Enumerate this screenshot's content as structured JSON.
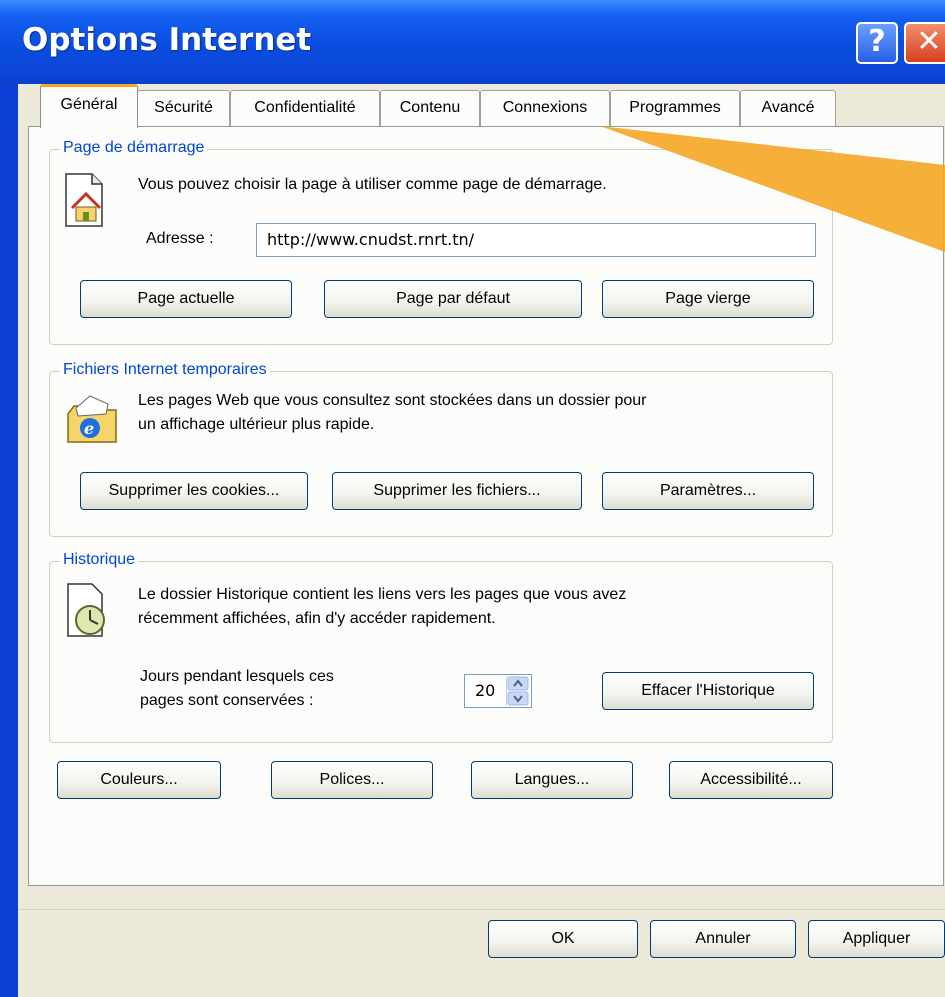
{
  "window": {
    "title": "Options Internet",
    "help_label": "?",
    "close_label": "✕"
  },
  "tabs": [
    "Général",
    "Sécurité",
    "Confidentialité",
    "Contenu",
    "Connexions",
    "Programmes",
    "Avancé"
  ],
  "home": {
    "legend": "Page de démarrage",
    "description": "Vous pouvez choisir la page à utiliser comme page de démarrage.",
    "address_label": "Adresse :",
    "address_value": "http://www.cnudst.rnrt.tn/",
    "buttons": [
      "Page actuelle",
      "Page par défaut",
      "Page vierge"
    ]
  },
  "temp": {
    "legend": "Fichiers Internet temporaires",
    "desc1": "Les pages Web que vous consultez sont stockées dans un dossier pour",
    "desc2": "un affichage ultérieur plus rapide.",
    "buttons": [
      "Supprimer les cookies...",
      "Supprimer les fichiers...",
      "Paramètres..."
    ]
  },
  "history": {
    "legend": "Historique",
    "desc1": "Le dossier Historique contient les liens vers les pages que vous avez",
    "desc2": "récemment affichées, afin d'y accéder rapidement.",
    "days_label1": "Jours pendant lesquels ces",
    "days_label2": "pages sont conservées :",
    "days_value": "20",
    "clear_button": "Effacer l'Historique"
  },
  "bottom_buttons": [
    "Couleurs...",
    "Polices...",
    "Langues...",
    "Accessibilité..."
  ],
  "footer_buttons": [
    "OK",
    "Annuler",
    "Appliquer"
  ],
  "colors": {
    "legend": "#0046d5",
    "active_tab_accent": "#f5a623",
    "titlebar": "#0a4de0",
    "arrow": "#f5a623"
  },
  "icons": {
    "home": "home-page-icon",
    "temp": "ie-folder-icon",
    "history": "history-clock-icon"
  }
}
